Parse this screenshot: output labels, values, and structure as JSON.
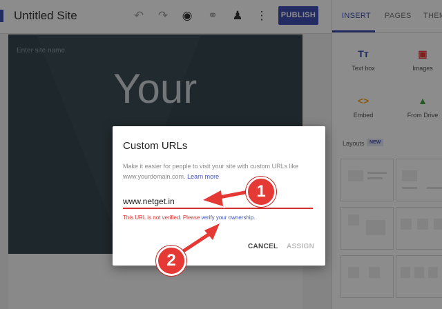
{
  "app": {
    "site_title": "Untitled Site",
    "publish_label": "PUBLISH"
  },
  "toolbar": {
    "icons": [
      "undo-icon",
      "redo-icon",
      "preview-eye-icon",
      "link-icon",
      "add-person-icon",
      "more-vert-icon"
    ]
  },
  "panel": {
    "tabs": [
      {
        "label": "INSERT"
      },
      {
        "label": "PAGES"
      },
      {
        "label": "THEM"
      }
    ],
    "tools": [
      {
        "label": "Text box",
        "icon": "text-box-icon"
      },
      {
        "label": "Images",
        "icon": "image-icon"
      },
      {
        "label": "Embed",
        "icon": "embed-code-icon"
      },
      {
        "label": "From Drive",
        "icon": "drive-icon"
      }
    ],
    "layouts_label": "Layouts",
    "new_badge": "NEW"
  },
  "canvas": {
    "site_name_placeholder": "Enter site name",
    "hero_text": "Your"
  },
  "dialog": {
    "title": "Custom URLs",
    "description": "Make it easier for people to visit your site with custom URLs like www.yourdomain.com.",
    "learn_more": "Learn more",
    "input_value": "www.netget.in",
    "error_text": "This URL is not verified. Please",
    "error_link": "verify your ownership.",
    "cancel_label": "CANCEL",
    "assign_label": "ASSIGN"
  },
  "callouts": {
    "one": "1",
    "two": "2"
  },
  "colors": {
    "accent": "#3f51b5",
    "error": "#d32f2f",
    "callout": "#e53935"
  }
}
